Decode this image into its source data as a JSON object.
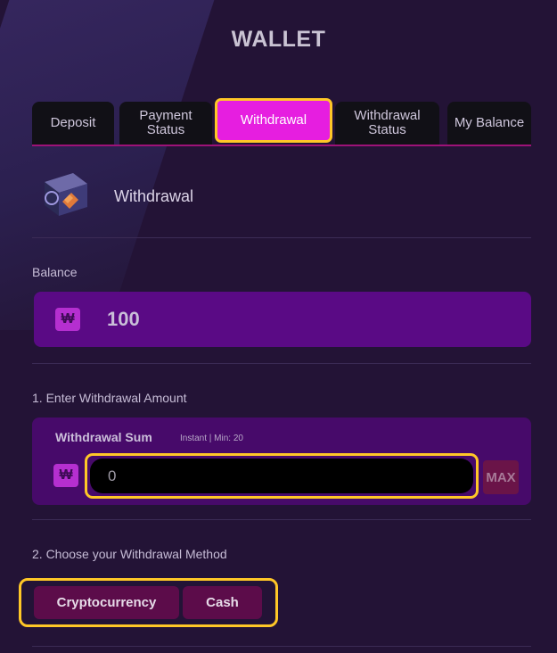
{
  "header": {
    "title": "WALLET"
  },
  "tabs": [
    {
      "label": "Deposit"
    },
    {
      "label": "Payment Status"
    },
    {
      "label": "Withdrawal"
    },
    {
      "label": "Withdrawal Status"
    },
    {
      "label": "My Balance"
    }
  ],
  "section": {
    "title": "Withdrawal"
  },
  "balance": {
    "label": "Balance",
    "currency_symbol": "₩",
    "value": "100"
  },
  "amount": {
    "step_label": "1. Enter Withdrawal Amount",
    "sum_label": "Withdrawal Sum",
    "hint": "Instant | Min: 20",
    "currency_symbol": "₩",
    "input_value": "0",
    "max_label": "MAX"
  },
  "method": {
    "step_label": "2. Choose your Withdrawal Method",
    "options": [
      {
        "label": "Cryptocurrency"
      },
      {
        "label": "Cash"
      }
    ]
  },
  "colors": {
    "background": "#231336",
    "accent": "#e61ee0",
    "highlight": "#ffc727",
    "balance_box": "#5a0a85"
  },
  "icons": {
    "section": "wallet-safe-icon",
    "currency": "won-icon"
  }
}
